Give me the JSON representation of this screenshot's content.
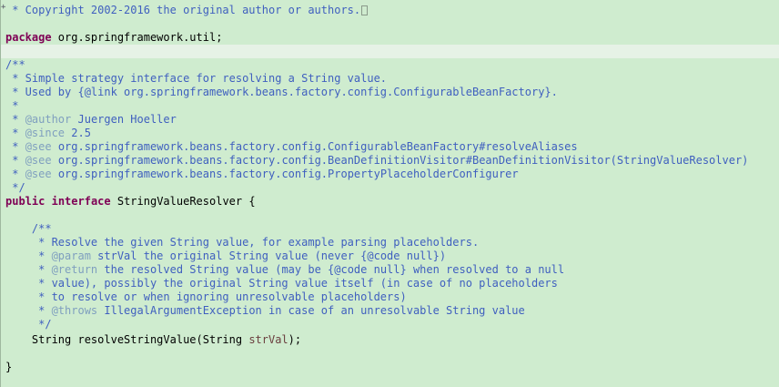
{
  "code": {
    "l1": " * Copyright 2002-2016 the original author or authors.",
    "l3_kw": "package",
    "l3_txt": " org.springframework.util;",
    "l5": "/**",
    "l6": " * Simple strategy interface for resolving a String value.",
    "l7": " * Used by {@link org.springframework.beans.factory.config.ConfigurableBeanFactory}.",
    "l8": " *",
    "l9_pre": " * ",
    "l9_tag": "@author",
    "l9_txt": " Juergen Hoeller",
    "l10_pre": " * ",
    "l10_tag": "@since",
    "l10_txt": " 2.5",
    "l11_pre": " * ",
    "l11_tag": "@see",
    "l11_txt": " org.springframework.beans.factory.config.ConfigurableBeanFactory#resolveAliases",
    "l12_pre": " * ",
    "l12_tag": "@see",
    "l12_txt": " org.springframework.beans.factory.config.BeanDefinitionVisitor#BeanDefinitionVisitor(StringValueResolver)",
    "l13_pre": " * ",
    "l13_tag": "@see",
    "l13_txt": " org.springframework.beans.factory.config.PropertyPlaceholderConfigurer",
    "l14": " */",
    "l15_kw1": "public",
    "l15_sp": " ",
    "l15_kw2": "interface",
    "l15_txt": " StringValueResolver {",
    "l17": "    /**",
    "l18": "     * Resolve the given String value, for example parsing placeholders.",
    "l19_pre": "     * ",
    "l19_tag": "@param",
    "l19_txt": " strVal the original String value (never {@code null})",
    "l20_pre": "     * ",
    "l20_tag": "@return",
    "l20_txt": " the resolved String value (may be {@code null} when resolved to a null",
    "l21": "     * value), possibly the original String value itself (in case of no placeholders",
    "l22": "     * to resolve or when ignoring unresolvable placeholders)",
    "l23_pre": "     * ",
    "l23_tag": "@throws",
    "l23_txt": " IllegalArgumentException in case of an unresolvable String value",
    "l24": "     */",
    "l25_txt": "    String resolveStringValue(String ",
    "l25_param": "strVal",
    "l25_end": ");",
    "l27": "}"
  },
  "gutter": {
    "fold_mark": "+"
  }
}
